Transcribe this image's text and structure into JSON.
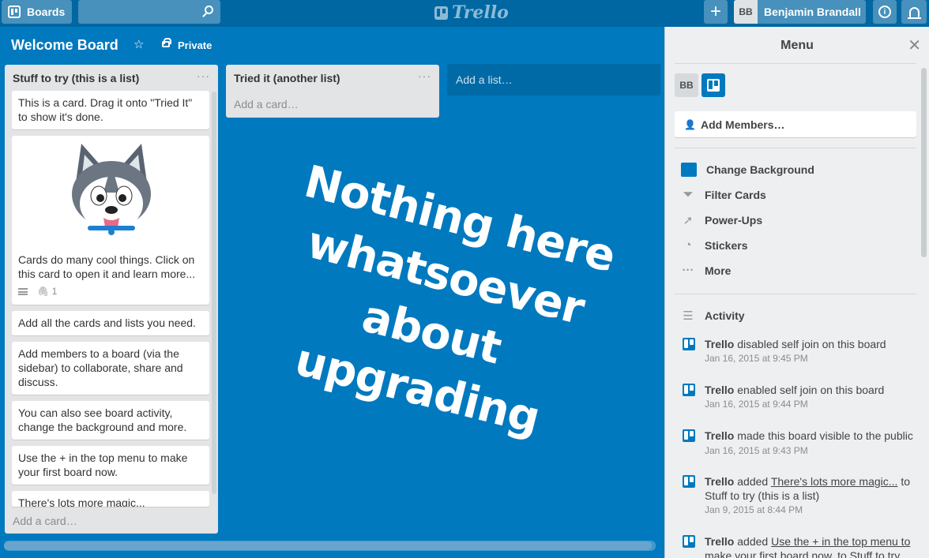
{
  "topbar": {
    "boards_label": "Boards",
    "search_value": "",
    "logo_text": "Trello",
    "add_label": "+",
    "user_initials": "BB",
    "user_name": "Benjamin Brandall",
    "info_label": "i"
  },
  "board": {
    "title": "Welcome Board",
    "visibility": "Private"
  },
  "lists": [
    {
      "title": "Stuff to try (this is a list)",
      "menu": "···",
      "cards": [
        "This is a card. Drag it onto \"Tried It\" to show it's done.",
        "Cards do many cool things. Click on this card to open it and learn more...",
        "Add all the cards and lists you need.",
        "Add members to a board (via the sidebar) to collaborate, share and discuss.",
        "You can also see board activity, change the background and more.",
        "Use the + in the top menu to make your first board now.",
        "There's lots more magic..."
      ],
      "attachment_count": "1",
      "add_card": "Add a card…"
    },
    {
      "title": "Tried it (another list)",
      "menu": "···",
      "add_card": "Add a card…"
    }
  ],
  "add_list": "Add a list…",
  "overlay_text": [
    "Nothing here",
    "whatsoever",
    "about upgrading"
  ],
  "sidebar": {
    "title": "Menu",
    "close": "✕",
    "member_initials": "BB",
    "add_members": "Add Members…",
    "items": [
      "Change Background",
      "Filter Cards",
      "Power-Ups",
      "Stickers",
      "More"
    ],
    "activity_title": "Activity",
    "activity": [
      {
        "actor": "Trello",
        "text": " disabled self join on this board",
        "time": "Jan 16, 2015 at 9:45 PM"
      },
      {
        "actor": "Trello",
        "text": " enabled self join on this board",
        "time": "Jan 16, 2015 at 9:44 PM"
      },
      {
        "actor": "Trello",
        "text": " made this board visible to the public",
        "time": "Jan 16, 2015 at 9:43 PM"
      },
      {
        "actor": "Trello",
        "text": " added ",
        "link": "There's lots more magic...",
        "text2": " to Stuff to try (this is a list)",
        "time": "Jan 9, 2015 at 8:44 PM"
      },
      {
        "actor": "Trello",
        "text": " added ",
        "link": "Use the + in the top menu to make your first board now.",
        "text2": " to Stuff to try",
        "time": ""
      }
    ]
  },
  "colors": {
    "board_bg": "#0079bf",
    "topbar": "#0067a3",
    "list_bg": "#e2e4e6",
    "sidebar_bg": "#edeff0"
  }
}
